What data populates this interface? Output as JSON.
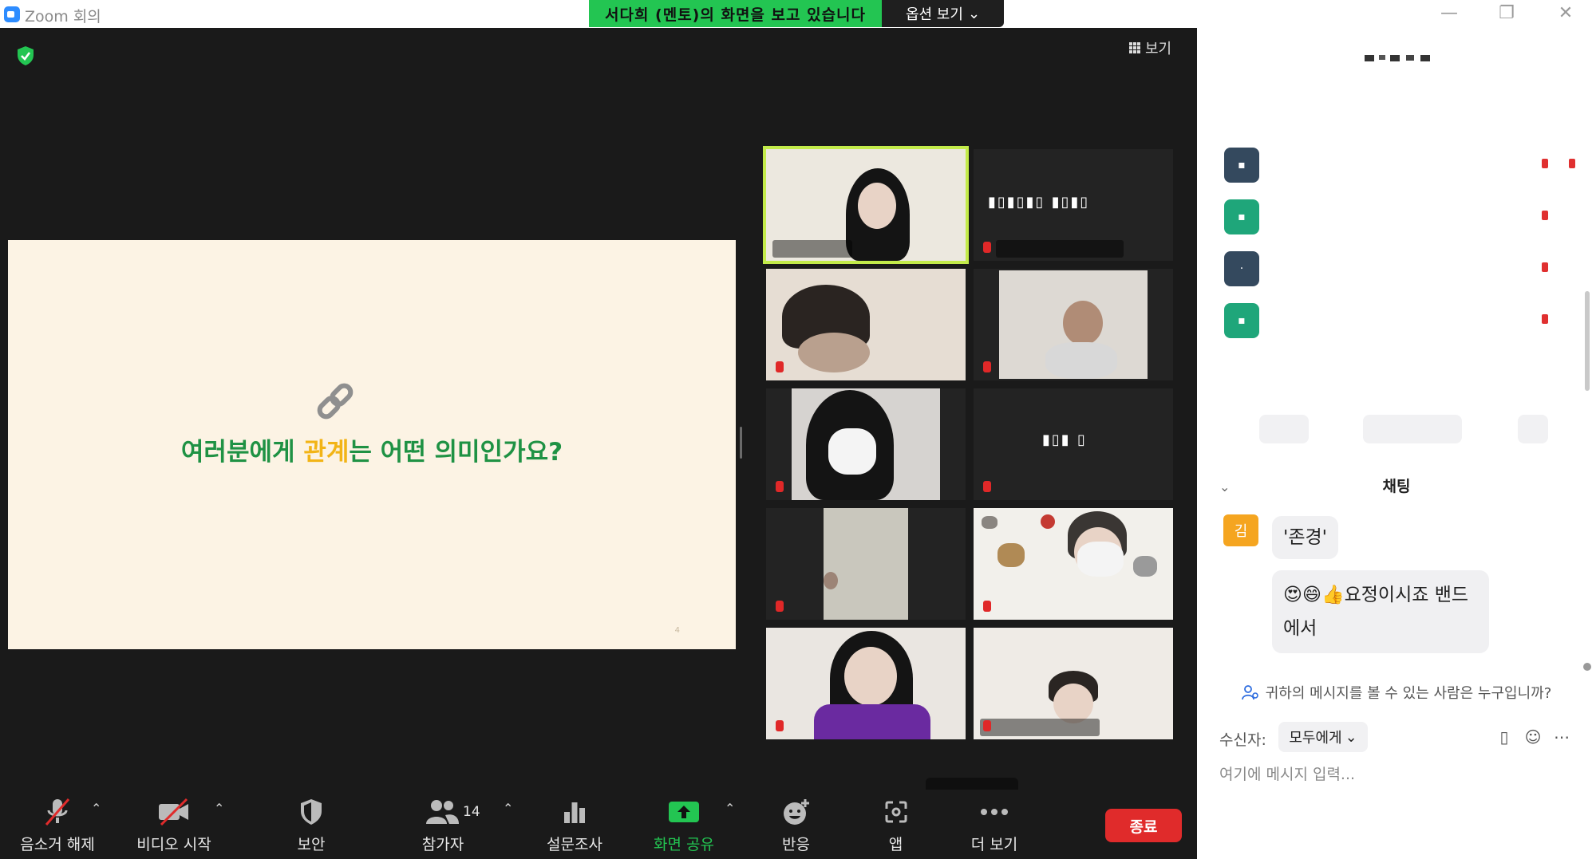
{
  "window": {
    "title": "Zoom 회의",
    "share_banner": "서다희 (멘토)의 화면을 보고 있습니다",
    "options_label": "옵션 보기",
    "minimize_glyph": "—",
    "restore_glyph": "❐",
    "close_glyph": "✕"
  },
  "meeting": {
    "view_label": "보기",
    "slide": {
      "question_before": "여러분에게 ",
      "question_highlight": "관계",
      "question_after": "는 어떤 의미인가요?",
      "page_number": "4"
    },
    "tiles": [
      {
        "id": "t1",
        "active": true
      },
      {
        "id": "t2"
      },
      {
        "id": "t3"
      },
      {
        "id": "t4"
      },
      {
        "id": "t5"
      },
      {
        "id": "t6"
      },
      {
        "id": "t7"
      },
      {
        "id": "t8"
      },
      {
        "id": "t9"
      },
      {
        "id": "t10"
      }
    ]
  },
  "toolbar": {
    "unmute": "음소거 해제",
    "start_video": "비디오 시작",
    "security": "보안",
    "participants": "참가자",
    "participants_count": "14",
    "polls": "설문조사",
    "share_screen": "화면 공유",
    "reactions": "반응",
    "apps": "앱",
    "more": "더 보기",
    "end": "종료",
    "share_color": "#23c552",
    "end_color": "#e02b2b"
  },
  "panel": {
    "chat_title": "채팅",
    "avatar_initial": "김",
    "messages": [
      {
        "text": "'존경'"
      },
      {
        "text": "😍😄👍요정이시죠 밴드에서"
      }
    ],
    "privacy_note": "귀하의 메시지를 볼 수 있는 사람은 누구입니까?",
    "to_label": "수신자:",
    "to_value": "모두에게",
    "input_placeholder": "여기에 메시지 입력..."
  }
}
